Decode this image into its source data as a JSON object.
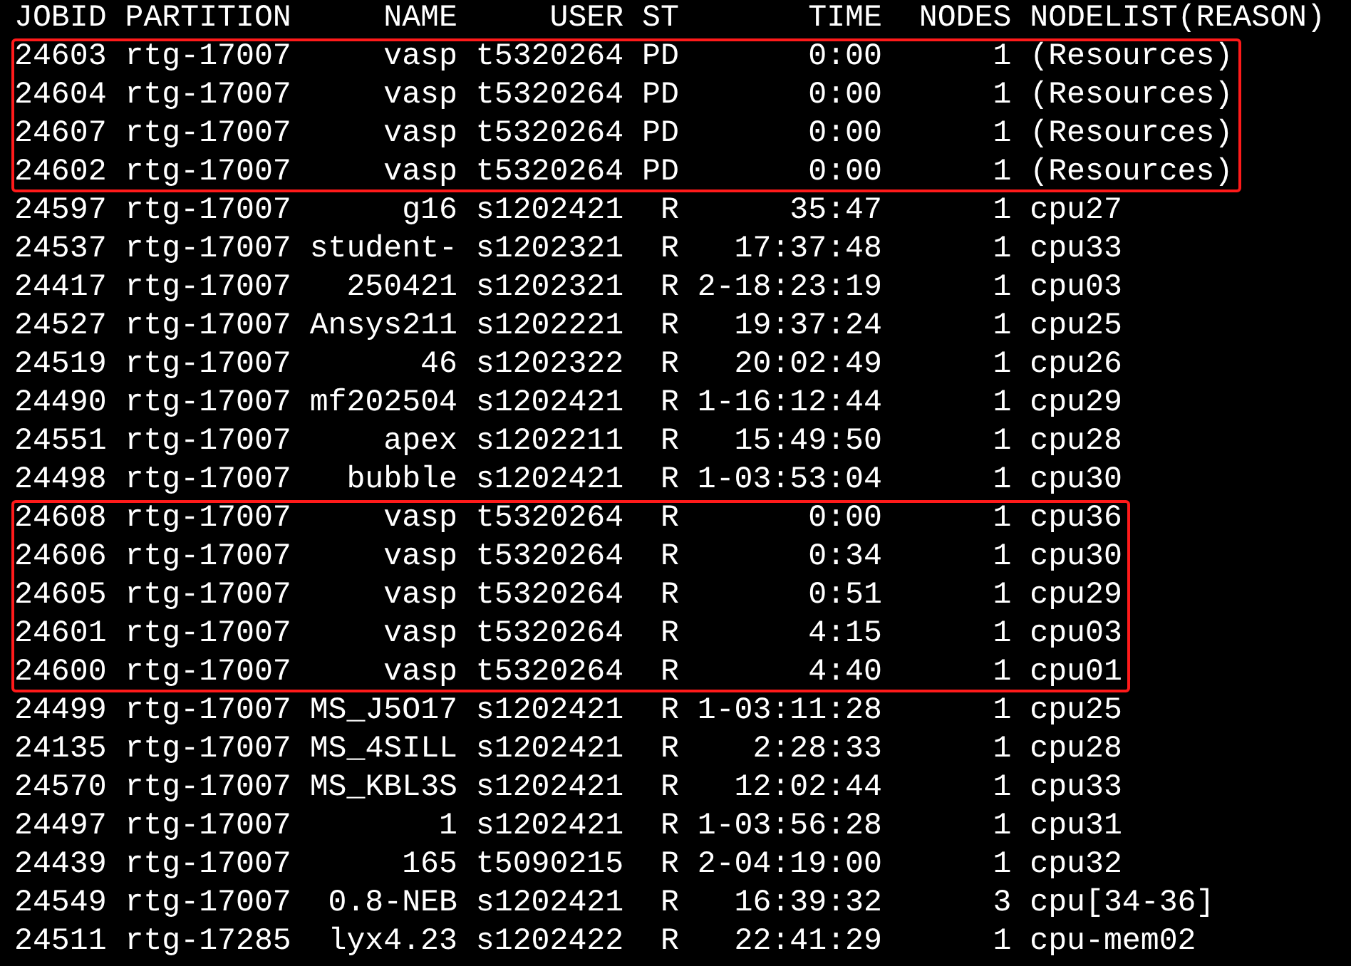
{
  "terminal": {
    "header": [
      "JOBID",
      "PARTITION",
      "NAME",
      "USER",
      "ST",
      "TIME",
      "NODES",
      "NODELIST(REASON)"
    ],
    "groups": [
      {
        "highlighted": true,
        "rows": [
          [
            "24603",
            "rtg-17007",
            "vasp",
            "t5320264",
            "PD",
            "0:00",
            "1",
            "(Resources)"
          ],
          [
            "24604",
            "rtg-17007",
            "vasp",
            "t5320264",
            "PD",
            "0:00",
            "1",
            "(Resources)"
          ],
          [
            "24607",
            "rtg-17007",
            "vasp",
            "t5320264",
            "PD",
            "0:00",
            "1",
            "(Resources)"
          ],
          [
            "24602",
            "rtg-17007",
            "vasp",
            "t5320264",
            "PD",
            "0:00",
            "1",
            "(Resources)"
          ]
        ]
      },
      {
        "highlighted": false,
        "rows": [
          [
            "24597",
            "rtg-17007",
            "g16",
            "s1202421",
            "R",
            "35:47",
            "1",
            "cpu27"
          ],
          [
            "24537",
            "rtg-17007",
            "student-",
            "s1202321",
            "R",
            "17:37:48",
            "1",
            "cpu33"
          ],
          [
            "24417",
            "rtg-17007",
            "250421",
            "s1202321",
            "R",
            "2-18:23:19",
            "1",
            "cpu03"
          ],
          [
            "24527",
            "rtg-17007",
            "Ansys211",
            "s1202221",
            "R",
            "19:37:24",
            "1",
            "cpu25"
          ],
          [
            "24519",
            "rtg-17007",
            "46",
            "s1202322",
            "R",
            "20:02:49",
            "1",
            "cpu26"
          ],
          [
            "24490",
            "rtg-17007",
            "mf202504",
            "s1202421",
            "R",
            "1-16:12:44",
            "1",
            "cpu29"
          ],
          [
            "24551",
            "rtg-17007",
            "apex",
            "s1202211",
            "R",
            "15:49:50",
            "1",
            "cpu28"
          ],
          [
            "24498",
            "rtg-17007",
            "bubble",
            "s1202421",
            "R",
            "1-03:53:04",
            "1",
            "cpu30"
          ]
        ]
      },
      {
        "highlighted": true,
        "rows": [
          [
            "24608",
            "rtg-17007",
            "vasp",
            "t5320264",
            "R",
            "0:00",
            "1",
            "cpu36"
          ],
          [
            "24606",
            "rtg-17007",
            "vasp",
            "t5320264",
            "R",
            "0:34",
            "1",
            "cpu30"
          ],
          [
            "24605",
            "rtg-17007",
            "vasp",
            "t5320264",
            "R",
            "0:51",
            "1",
            "cpu29"
          ],
          [
            "24601",
            "rtg-17007",
            "vasp",
            "t5320264",
            "R",
            "4:15",
            "1",
            "cpu03"
          ],
          [
            "24600",
            "rtg-17007",
            "vasp",
            "t5320264",
            "R",
            "4:40",
            "1",
            "cpu01"
          ]
        ]
      },
      {
        "highlighted": false,
        "rows": [
          [
            "24499",
            "rtg-17007",
            "MS_J5O17",
            "s1202421",
            "R",
            "1-03:11:28",
            "1",
            "cpu25"
          ],
          [
            "24135",
            "rtg-17007",
            "MS_4SILL",
            "s1202421",
            "R",
            "2:28:33",
            "1",
            "cpu28"
          ],
          [
            "24570",
            "rtg-17007",
            "MS_KBL3S",
            "s1202421",
            "R",
            "12:02:44",
            "1",
            "cpu33"
          ],
          [
            "24497",
            "rtg-17007",
            "1",
            "s1202421",
            "R",
            "1-03:56:28",
            "1",
            "cpu31"
          ],
          [
            "24439",
            "rtg-17007",
            "165",
            "t5090215",
            "R",
            "2-04:19:00",
            "1",
            "cpu32"
          ],
          [
            "24549",
            "rtg-17007",
            "0.8-NEB",
            "s1202421",
            "R",
            "16:39:32",
            "3",
            "cpu[34-36]"
          ],
          [
            "24511",
            "rtg-17285",
            "lyx4.23",
            "s1202422",
            "R",
            "22:41:29",
            "1",
            "cpu-mem02"
          ]
        ]
      }
    ]
  }
}
